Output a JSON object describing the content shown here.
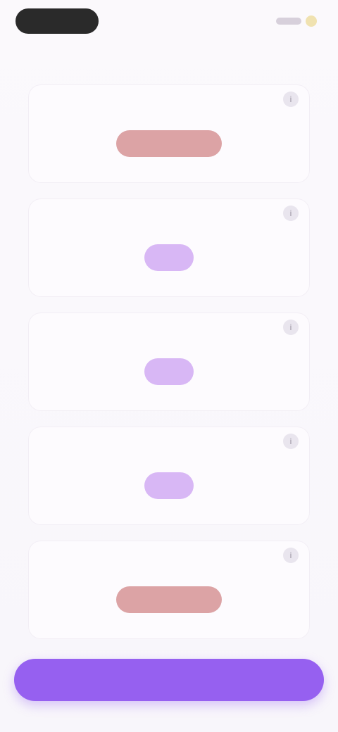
{
  "status": {
    "time": "",
    "signal": "",
    "battery": ""
  },
  "header": {
    "title": ""
  },
  "cards": [
    {
      "title": "",
      "subtitle": "",
      "badge": "",
      "badge_color": "#dca3a5",
      "icon": "info-icon"
    },
    {
      "title": "",
      "subtitle": "",
      "badge": "",
      "badge_color": "#d8b7f5",
      "icon": "info-icon"
    },
    {
      "title": "",
      "subtitle": "",
      "badge": "",
      "badge_color": "#d8b7f5",
      "icon": "info-icon"
    },
    {
      "title": "",
      "subtitle": "",
      "badge": "",
      "badge_color": "#d8b7f5",
      "icon": "info-icon"
    },
    {
      "title": "",
      "subtitle": "",
      "badge": "",
      "badge_color": "#dca3a5",
      "icon": "info-icon"
    }
  ],
  "cta": {
    "label": ""
  },
  "colors": {
    "accent": "#9660f0",
    "badge_red": "#dca3a5",
    "badge_purple": "#d8b7f5"
  }
}
